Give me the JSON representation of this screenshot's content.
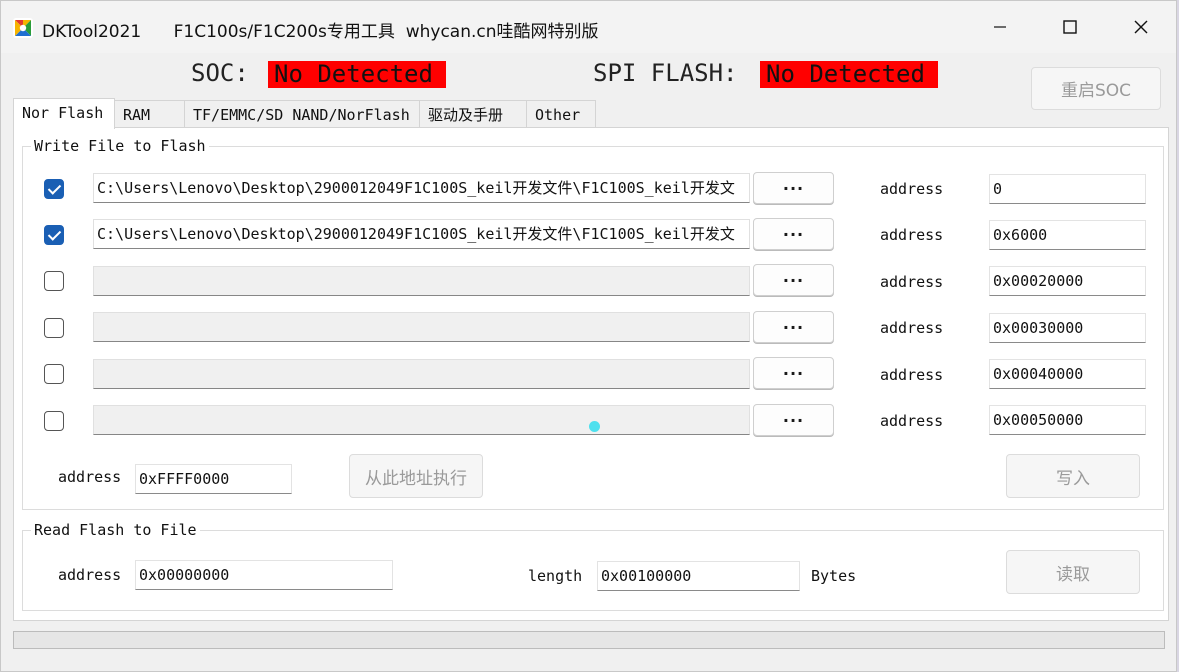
{
  "window": {
    "app_name": "DKTool2021",
    "subtitle": "F1C100s/F1C200s专用工具  whycan.cn哇酷网特别版"
  },
  "status": {
    "soc_label": "SOC:",
    "soc_value": "No Detected",
    "spi_label": "SPI FLASH:",
    "spi_value": "No Detected",
    "restart_button": "重启SOC",
    "alert_color": "#ff0000"
  },
  "tabs": [
    {
      "label": "Nor Flash",
      "active": true
    },
    {
      "label": "RAM",
      "active": false
    },
    {
      "label": "TF/EMMC/SD NAND/NorFlash",
      "active": false
    },
    {
      "label": "驱动及手册",
      "active": false
    },
    {
      "label": "Other",
      "active": false
    }
  ],
  "write_group": {
    "title": "Write File to Flash",
    "browse_label": "···",
    "address_label": "address",
    "rows": [
      {
        "checked": true,
        "path": "C:\\Users\\Lenovo\\Desktop\\2900012049F1C100S_keil开发文件\\F1C100S_keil开发文",
        "address": "0"
      },
      {
        "checked": true,
        "path": "C:\\Users\\Lenovo\\Desktop\\2900012049F1C100S_keil开发文件\\F1C100S_keil开发文",
        "address": "0x6000"
      },
      {
        "checked": false,
        "path": "",
        "address": "0x00020000"
      },
      {
        "checked": false,
        "path": "",
        "address": "0x00030000"
      },
      {
        "checked": false,
        "path": "",
        "address": "0x00040000"
      },
      {
        "checked": false,
        "path": "",
        "address": "0x00050000"
      }
    ],
    "exec_address_label": "address",
    "exec_address_value": "0xFFFF0000",
    "exec_button": "从此地址执行",
    "write_button": "写入"
  },
  "read_group": {
    "title": "Read Flash to File",
    "address_label": "address",
    "address_value": "0x00000000",
    "length_label": "length",
    "length_value": "0x00100000",
    "unit_label": "Bytes",
    "read_button": "读取"
  },
  "progress": {
    "value": 0
  }
}
